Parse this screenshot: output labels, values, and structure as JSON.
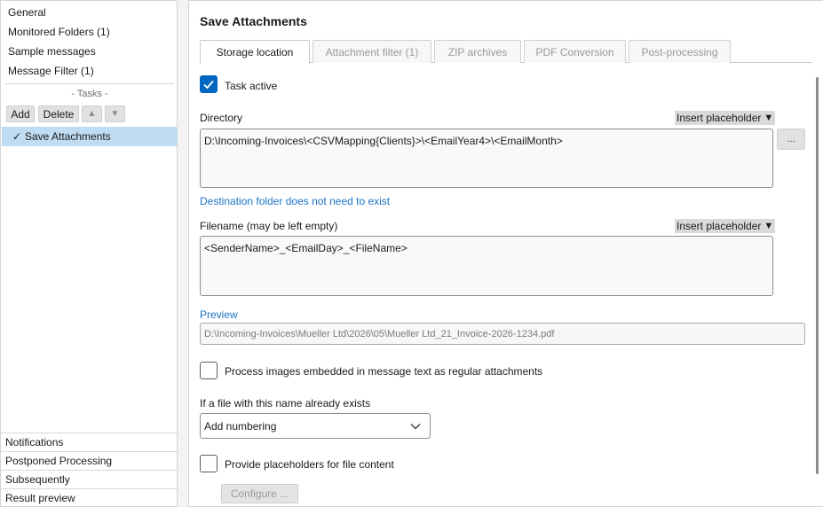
{
  "left_panel": {
    "items": [
      {
        "label": "General"
      },
      {
        "label": "Monitored Folders (1)"
      },
      {
        "label": "Sample messages"
      },
      {
        "label": "Message Filter (1)"
      }
    ],
    "tasks_label": "- Tasks -",
    "buttons": {
      "add": "Add",
      "delete": "Delete",
      "up": "▲",
      "down": "▼"
    },
    "selected_task": {
      "check": "✓",
      "label": "Save Attachments"
    },
    "bottom_items": [
      {
        "label": "Notifications"
      },
      {
        "label": "Postponed Processing"
      },
      {
        "label": "Subsequently"
      },
      {
        "label": "Result preview"
      }
    ]
  },
  "main": {
    "title": "Save Attachments",
    "tabs": [
      {
        "label": "Storage location",
        "active": true
      },
      {
        "label": "Attachment filter (1)",
        "active": false
      },
      {
        "label": "ZIP archives",
        "active": false
      },
      {
        "label": "PDF Conversion",
        "active": false
      },
      {
        "label": "Post-processing",
        "active": false
      }
    ],
    "task_active": {
      "label": "Task active",
      "checked": true
    },
    "directory": {
      "label": "Directory",
      "value": "D:\\Incoming-Invoices\\<CSVMapping{Clients}>\\<EmailYear4>\\<EmailMonth>",
      "hint": "Destination folder does not need to exist",
      "browse_label": "..."
    },
    "insert_placeholder": "Insert placeholder",
    "insert_placeholder_arrow": "▼",
    "filename": {
      "label": "Filename (may be left empty)",
      "value": "<SenderName>_<EmailDay>_<FileName>"
    },
    "preview": {
      "label": "Preview",
      "value": "D:\\Incoming-Invoices\\Mueller Ltd\\2026\\05\\Mueller Ltd_21_Invoice-2026-1234.pdf"
    },
    "process_images": {
      "label": "Process images embedded in message text as regular attachments",
      "checked": false
    },
    "file_exists": {
      "label": "If a file with this name already exists",
      "selected": "Add numbering"
    },
    "provide_placeholders": {
      "label": "Provide placeholders for file content",
      "checked": false
    },
    "configure_label": "Configure ..."
  },
  "colors": {
    "accent": "#0067c0",
    "selection": "#bfdcf3",
    "link": "#1b74c4"
  }
}
